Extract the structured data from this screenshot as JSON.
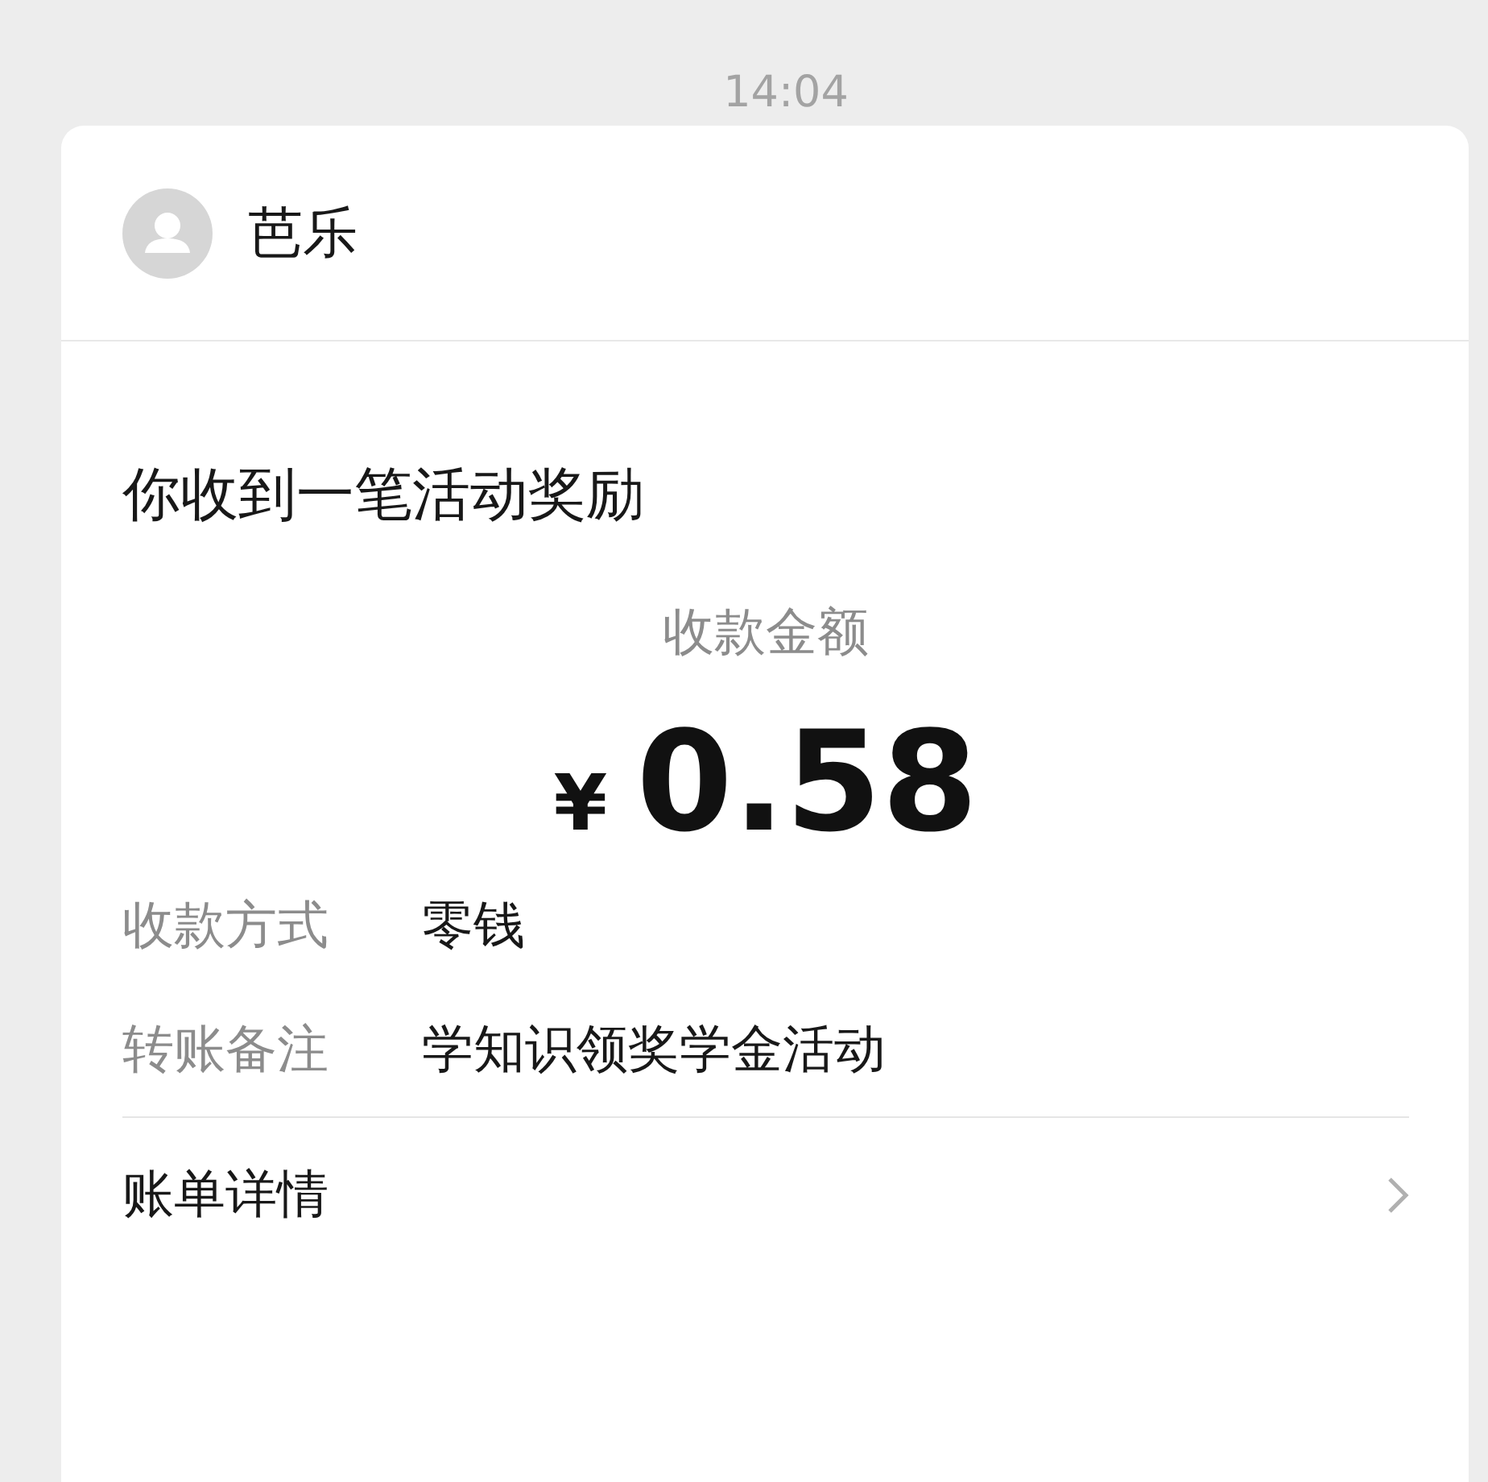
{
  "time": "14:04",
  "sender": {
    "name": "芭乐"
  },
  "message": {
    "title": "你收到一笔活动奖励",
    "amount_label": "收款金额",
    "currency": "¥",
    "amount": "0.58",
    "details": [
      {
        "label": "收款方式",
        "value": "零钱"
      },
      {
        "label": "转账备注",
        "value": "学知识领奖学金活动"
      }
    ],
    "footer_link": "账单详情"
  }
}
